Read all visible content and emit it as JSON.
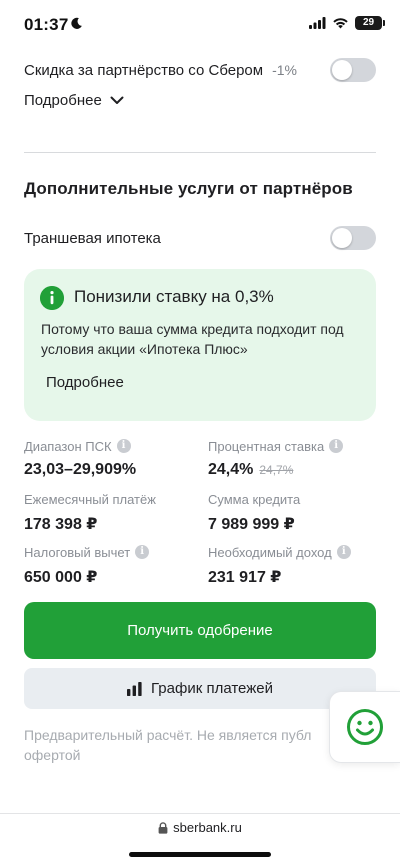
{
  "status_bar": {
    "time": "01:37",
    "battery": "29"
  },
  "partner_discount": {
    "label": "Скидка за партнёрство со Сбером",
    "badge": "-1%"
  },
  "more_link": "Подробнее",
  "services": {
    "title": "Дополнительные услуги от партнёров",
    "tranche": {
      "label": "Траншевая ипотека"
    }
  },
  "promo": {
    "title": "Понизили ставку на 0,3%",
    "text": "Потому что ваша сумма кредита подходит под условия акции «Ипотека Плюс»",
    "link": "Подробнее"
  },
  "stats": {
    "psk": {
      "label": "Диапазон ПСК",
      "value": "23,03–29,909%"
    },
    "rate": {
      "label": "Процентная ставка",
      "value": "24,4%",
      "old": "24,7%"
    },
    "monthly": {
      "label": "Ежемесячный платёж",
      "value": "178 398 ₽"
    },
    "loan": {
      "label": "Сумма кредита",
      "value": "7 989 999 ₽"
    },
    "tax": {
      "label": "Налоговый вычет",
      "value": "650 000 ₽"
    },
    "income": {
      "label": "Необходимый доход",
      "value": "231 917 ₽"
    }
  },
  "actions": {
    "approve": "Получить одобрение",
    "schedule": "График платежей"
  },
  "disclaimer": {
    "line1": "Предварительный расчёт. Не является публ",
    "line2": "офертой"
  },
  "browser": {
    "url": "sberbank.ru"
  },
  "colors": {
    "brand": "#21a038",
    "promo_bg": "#e6f7ea",
    "toggle_off": "#d3d6db"
  }
}
